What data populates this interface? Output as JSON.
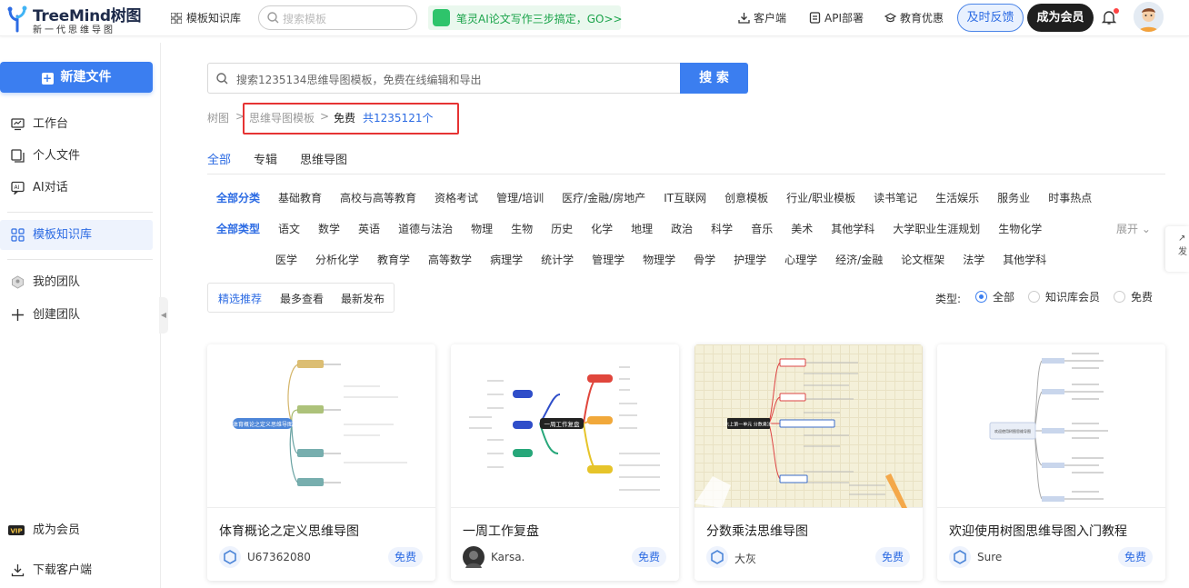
{
  "header": {
    "logo_name": "TreeMind树图",
    "logo_sub": "新一代思维导图",
    "nav_templates": "模板知识库",
    "search_placeholder": "搜索模板",
    "promo": "笔灵AI论文写作三步搞定，GO>>",
    "client": "客户端",
    "api": "API部署",
    "edu": "教育优惠",
    "feedback": "及时反馈",
    "vip": "成为会员"
  },
  "sidebar": {
    "new_file": "新建文件",
    "items": [
      {
        "label": "工作台"
      },
      {
        "label": "个人文件"
      },
      {
        "label": "AI对话"
      },
      {
        "label": "模板知识库"
      },
      {
        "label": "我的团队"
      },
      {
        "label": "创建团队"
      }
    ],
    "vip": "成为会员",
    "download": "下载客户端"
  },
  "search": {
    "placeholder": "搜索1235134思维导图模板，免费在线编辑和导出",
    "button": "搜 索"
  },
  "breadcrumb": {
    "root": "树图",
    "sep": ">",
    "level1": "思维导图模板",
    "level2": "免费",
    "count_prefix": "共",
    "count": "1235121",
    "count_suffix": "个"
  },
  "content_tabs": [
    "全部",
    "专辑",
    "思维导图"
  ],
  "filters": {
    "category_label": "全部分类",
    "categories": [
      "基础教育",
      "高校与高等教育",
      "资格考试",
      "管理/培训",
      "医疗/金融/房地产",
      "IT互联网",
      "创意模板",
      "行业/职业模板",
      "读书笔记",
      "生活娱乐",
      "服务业",
      "时事热点"
    ],
    "type_label": "全部类型",
    "types_row1": [
      "语文",
      "数学",
      "英语",
      "道德与法治",
      "物理",
      "生物",
      "历史",
      "化学",
      "地理",
      "政治",
      "科学",
      "音乐",
      "美术",
      "其他学科",
      "大学职业生涯规划",
      "生物化学"
    ],
    "types_row2": [
      "医学",
      "分析化学",
      "教育学",
      "高等数学",
      "病理学",
      "统计学",
      "管理学",
      "物理学",
      "骨学",
      "护理学",
      "心理学",
      "经济/金融",
      "论文框架",
      "法学",
      "其他学科"
    ],
    "expand": "展开"
  },
  "sort": [
    "精选推荐",
    "最多查看",
    "最新发布"
  ],
  "type_filter": {
    "label": "类型:",
    "options": [
      "全部",
      "知识库会员",
      "免费"
    ],
    "selected": "全部"
  },
  "cards": [
    {
      "title": "体育概论之定义思维导图",
      "user": "U67362080",
      "badge": "免费",
      "center": "体育概论之定义思维导图"
    },
    {
      "title": "一周工作复盘",
      "user": "Karsa.",
      "badge": "免费",
      "center": "一周工作复盘"
    },
    {
      "title": "分数乘法思维导图",
      "user": "大灰",
      "badge": "免费",
      "center": "六上第一单元 分数乘法"
    },
    {
      "title": "欢迎使用树图思维导图入门教程",
      "user": "Sure",
      "badge": "免费",
      "center": "欢迎使用树图思维导图"
    }
  ],
  "right_tab": "发",
  "colors": {
    "accent": "#3b7ef0",
    "highlight_box": "#e63333",
    "promo_green": "#1aa34a"
  }
}
